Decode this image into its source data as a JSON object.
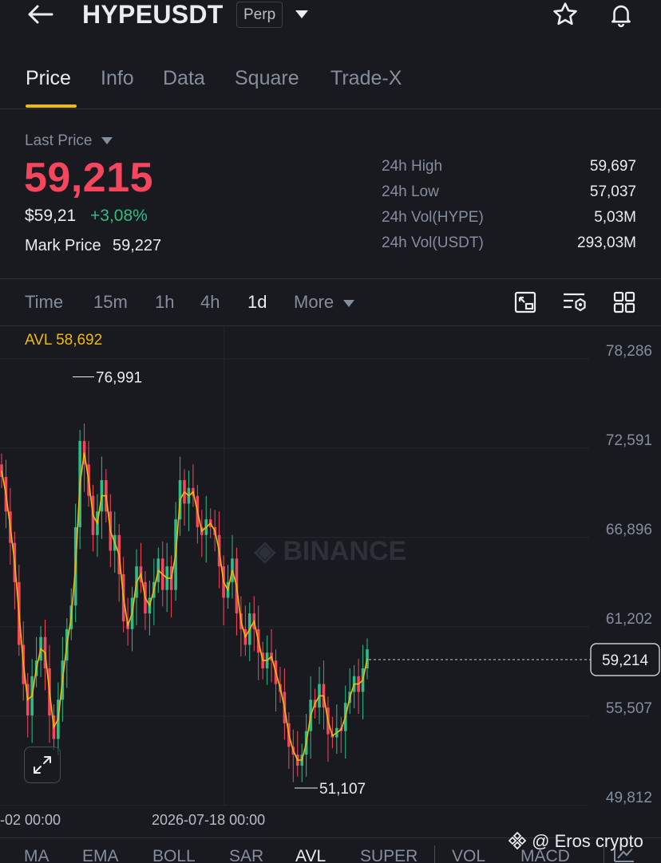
{
  "header": {
    "symbol": "HYPEUSDT",
    "contract_type": "Perp",
    "icons": [
      "back-arrow-icon",
      "dropdown-caret-icon",
      "star-icon",
      "bell-icon"
    ]
  },
  "tabs": [
    {
      "label": "Price",
      "active": true
    },
    {
      "label": "Info",
      "active": false
    },
    {
      "label": "Data",
      "active": false
    },
    {
      "label": "Square",
      "active": false
    },
    {
      "label": "Trade-X",
      "active": false
    }
  ],
  "price_panel": {
    "last_price_label": "Last Price",
    "last_price": "59,215",
    "fiat_price": "$59,21",
    "change": "+3,08%",
    "mark_price_label": "Mark Price",
    "mark_price": "59,227",
    "colors": {
      "down": "#f6465d",
      "up": "#2ebd85",
      "accent": "#f0b90b"
    }
  },
  "stats": [
    {
      "label": "24h High",
      "value": "59,697"
    },
    {
      "label": "24h Low",
      "value": "57,037"
    },
    {
      "label": "24h Vol(HYPE)",
      "value": "5,03M"
    },
    {
      "label": "24h Vol(USDT)",
      "value": "293,03M"
    }
  ],
  "timeframes": {
    "items": [
      "Time",
      "15m",
      "1h",
      "4h",
      "1d"
    ],
    "selected": "1d",
    "more_label": "More",
    "tool_icons": [
      "chart-type-icon",
      "indicator-settings-icon",
      "layout-grid-icon"
    ]
  },
  "chart_data": {
    "type": "candlestick",
    "indicator_label": "AVL 58,692",
    "watermark": "BINANCE",
    "y_ticks": [
      "78,286",
      "72,591",
      "66,896",
      "61,202",
      "55,507",
      "49,812"
    ],
    "y_tick_values": [
      78286,
      72591,
      66896,
      61202,
      55507,
      49812
    ],
    "x_ticks": [
      "-02 00:00",
      "2026-07-18 00:00"
    ],
    "high_marker": "76,991",
    "low_marker": "51,107",
    "current_price_tag": "59,214",
    "closes": [
      70200,
      68000,
      66000,
      63500,
      59500,
      57000,
      55000,
      57500,
      58500,
      60000,
      58000,
      55000,
      53500,
      56000,
      58500,
      60500,
      62000,
      67000,
      72500,
      71000,
      69000,
      66500,
      68000,
      70000,
      68000,
      65500,
      66500,
      64000,
      61000,
      60500,
      62500,
      64500,
      63500,
      61500,
      62500,
      63500,
      65000,
      63000,
      64500,
      63000,
      67500,
      70000,
      68500,
      69500,
      69000,
      67000,
      66500,
      67500,
      67000,
      66500,
      64500,
      62500,
      63500,
      65000,
      61500,
      60500,
      59500,
      61500,
      60500,
      59000,
      58000,
      59000,
      58500,
      57000,
      56500,
      54500,
      53000,
      52500,
      51800,
      52500,
      54000,
      56000,
      55500,
      57000,
      55500,
      53800,
      53600,
      54200,
      54000,
      55800,
      56500,
      57500,
      56500,
      58000,
      59214
    ],
    "ohlc_summary": {
      "high": 76991,
      "low": 51107,
      "last": 59214
    }
  },
  "indicators": {
    "items": [
      "MA",
      "EMA",
      "BOLL",
      "SAR",
      "AVL",
      "SUPER",
      "VOL",
      "MACD"
    ],
    "selected": "AVL"
  },
  "footer_watermark": "@ Eros crypto"
}
